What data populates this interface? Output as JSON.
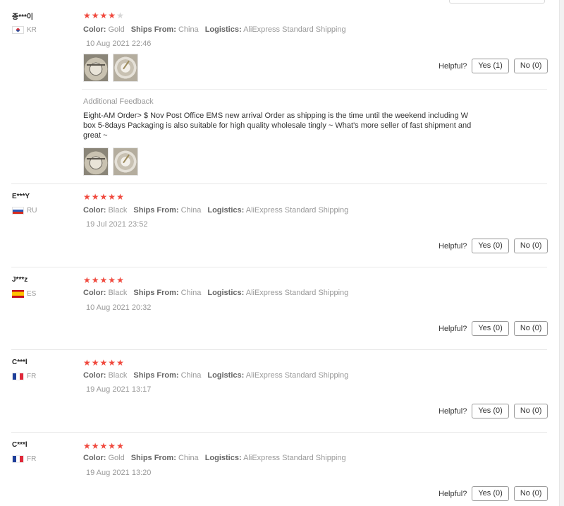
{
  "labels": {
    "color": "Color:",
    "ships_from": "Ships From:",
    "logistics": "Logistics:",
    "helpful": "Helpful?",
    "additional_feedback": "Additional Feedback"
  },
  "colors": {
    "star_on": "#f0493e",
    "star_off": "#d6d6d6"
  },
  "reviews": [
    {
      "user": "종***이",
      "country": "KR",
      "flag_icon": "flag-kr-icon",
      "rating": 4,
      "color": "Gold",
      "ships_from": "China",
      "logistics": "AliExpress Standard Shipping",
      "date": "10 Aug 2021 22:46",
      "yes": "Yes (1)",
      "no": "No (0)",
      "photos": [
        "review-photo-clock-1",
        "review-photo-clock-2"
      ],
      "additional_feedback": {
        "text": "Eight-AM Order> $ Nov Post Office EMS new arrival Order as shipping is the time until the weekend including W box 5-8days Packaging is also suitable for high quality wholesale tingly ~ What's more seller of fast shipment and great ~",
        "photos": [
          "review-photo-clock-1",
          "review-photo-clock-2"
        ]
      }
    },
    {
      "user": "E***Y",
      "country": "RU",
      "flag_icon": "flag-ru-icon",
      "rating": 5,
      "color": "Black",
      "ships_from": "China",
      "logistics": "AliExpress Standard Shipping",
      "date": "19 Jul 2021 23:52",
      "yes": "Yes (0)",
      "no": "No (0)"
    },
    {
      "user": "J***z",
      "country": "ES",
      "flag_icon": "flag-es-icon",
      "rating": 5,
      "color": "Black",
      "ships_from": "China",
      "logistics": "AliExpress Standard Shipping",
      "date": "10 Aug 2021 20:32",
      "yes": "Yes (0)",
      "no": "No (0)"
    },
    {
      "user": "C***l",
      "country": "FR",
      "flag_icon": "flag-fr-icon",
      "rating": 5,
      "color": "Black",
      "ships_from": "China",
      "logistics": "AliExpress Standard Shipping",
      "date": "19 Aug 2021 13:17",
      "yes": "Yes (0)",
      "no": "No (0)"
    },
    {
      "user": "C***l",
      "country": "FR",
      "flag_icon": "flag-fr-icon",
      "rating": 5,
      "color": "Gold",
      "ships_from": "China",
      "logistics": "AliExpress Standard Shipping",
      "date": "19 Aug 2021 13:20",
      "yes": "Yes (0)",
      "no": "No (0)"
    }
  ]
}
